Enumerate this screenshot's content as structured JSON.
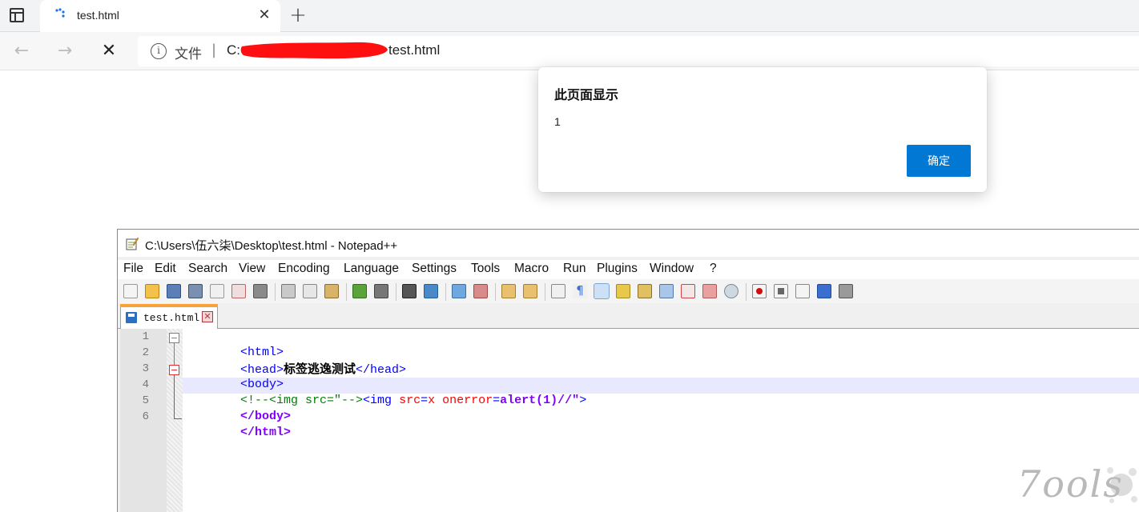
{
  "browser": {
    "tab_title": "test.html",
    "tab_close": "✕",
    "new_tab": "+",
    "back": "←",
    "forward": "→",
    "stop": "✕",
    "address_label": "文件",
    "address_sep": "|",
    "url_start": "C:",
    "url_end": "test.html",
    "accent": "#0078d4"
  },
  "dialog": {
    "title": "此页面显示",
    "message": "1",
    "ok_label": "确定"
  },
  "notepad": {
    "title": "C:\\Users\\伍六柒\\Desktop\\test.html - Notepad++",
    "menu": [
      "File",
      "Edit",
      "Search",
      "View",
      "Encoding",
      "Language",
      "Settings",
      "Tools",
      "Macro",
      "Run",
      "Plugins",
      "Window",
      "?"
    ],
    "doc_tab": "test.html",
    "doc_tab_close": "✕",
    "line_numbers": [
      "1",
      "2",
      "3",
      "4",
      "5",
      "6"
    ],
    "code": {
      "l1": "<html>",
      "l2_open": "<head>",
      "l2_text": "标签逃逸测试",
      "l2_close": "</head>",
      "l3": "<body>",
      "l4_comment": "<!--<img src=\"-->",
      "l4_tag": "<img",
      "l4_attr1": "src",
      "l4_eq1": "=",
      "l4_val1": "x",
      "l4_attr2": "onerror",
      "l4_eq2": "=",
      "l4_val2": "alert(1)//\"",
      "l4_end": ">",
      "l5": "</body>",
      "l6": "</html>"
    }
  },
  "watermark": {
    "text": "7ools"
  }
}
